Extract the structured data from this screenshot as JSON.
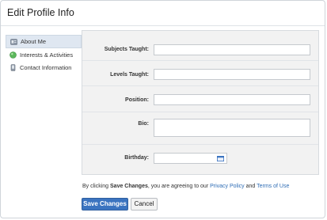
{
  "page": {
    "title": "Edit Profile Info"
  },
  "sidebar": {
    "items": [
      {
        "label": "About Me",
        "icon": "id-card-icon",
        "active": true
      },
      {
        "label": "Interests & Activities",
        "icon": "green-dot-icon",
        "active": false
      },
      {
        "label": "Contact Information",
        "icon": "phone-icon",
        "active": false
      }
    ]
  },
  "form": {
    "fields": [
      {
        "label": "Subjects Taught:",
        "value": ""
      },
      {
        "label": "Levels Taught:",
        "value": ""
      },
      {
        "label": "Position:",
        "value": ""
      },
      {
        "label": "Bio:",
        "value": ""
      },
      {
        "label": "Birthday:",
        "value": "",
        "icon": "calendar-icon"
      }
    ]
  },
  "footer": {
    "text_pre": "By clicking ",
    "text_bold": "Save Changes",
    "text_mid": ", you are agreeing to our ",
    "privacy_link": "Privacy Policy",
    "text_and": " and ",
    "terms_link": "Terms of Use"
  },
  "buttons": {
    "save_label": "Save Changes",
    "cancel_label": "Cancel"
  },
  "colors": {
    "accent": "#3b74c0",
    "link": "#2f6db5",
    "active_tab_bg": "#dfe7f1",
    "content_bg": "#f2f2f2"
  }
}
